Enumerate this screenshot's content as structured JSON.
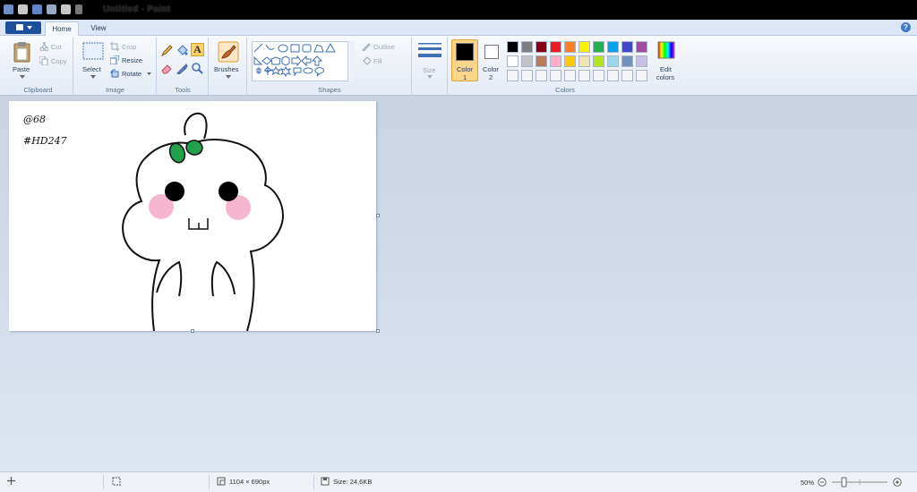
{
  "window": {
    "title": "Untitled - Paint"
  },
  "tabs": [
    {
      "label": "Home",
      "active": true
    },
    {
      "label": "View",
      "active": false
    }
  ],
  "ribbon": {
    "clipboard": {
      "paste": "Paste",
      "cut": "Cut",
      "copy": "Copy",
      "group_label": "Clipboard"
    },
    "image": {
      "select": "Select",
      "crop": "Crop",
      "resize": "Resize",
      "rotate": "Rotate",
      "group_label": "Image"
    },
    "tools": {
      "group_label": "Tools"
    },
    "brushes": {
      "label": "Brushes"
    },
    "shapes": {
      "outline": "Outline",
      "fill": "Fill",
      "group_label": "Shapes"
    },
    "size": {
      "label": "Size"
    },
    "colors": {
      "color1_label": "Color",
      "color1_num": "1",
      "color2_label": "Color",
      "color2_num": "2",
      "edit_colors": "Edit",
      "edit_colors_2": "colors",
      "group_label": "Colors",
      "color1": "#000000",
      "color2": "#ffffff",
      "palette_row1": [
        "#000000",
        "#7f7f7f",
        "#880015",
        "#ed1c24",
        "#ff7f27",
        "#fff200",
        "#22b14c",
        "#00a2e8",
        "#3f48cc",
        "#a349a4"
      ],
      "palette_row2": [
        "#ffffff",
        "#c3c3c3",
        "#b97a57",
        "#ffaec9",
        "#ffc90e",
        "#efe4b0",
        "#b5e61d",
        "#99d9ea",
        "#7092be",
        "#c8bfe7"
      ],
      "palette_row3": [
        "#f5f5f5",
        "#f5f5f5",
        "#f5f5f5",
        "#f5f5f5",
        "#f5f5f5",
        "#f5f5f5",
        "#f5f5f5",
        "#f5f5f5",
        "#f5f5f5",
        "#f5f5f5"
      ]
    }
  },
  "canvas": {
    "text_line1": "@68",
    "text_line2": "#HD247",
    "leaf_color": "#22a04a",
    "cheek_color": "#f6b6d0"
  },
  "statusbar": {
    "dimensions": "1104 × 690px",
    "size": "Size: 24,6KB",
    "zoom": "50%"
  }
}
